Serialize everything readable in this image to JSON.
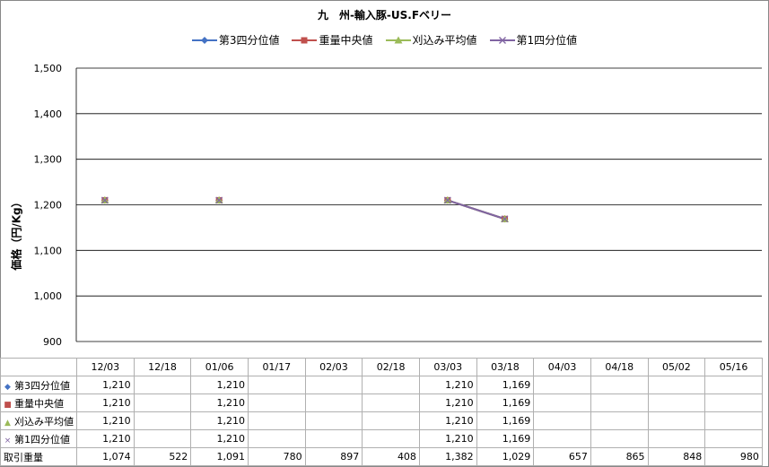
{
  "chart_data": {
    "type": "line",
    "title": "九　州-輸入豚-US.Fベリー",
    "ylabel": "価格（円/Kg）",
    "ylim": [
      900,
      1500
    ],
    "yticks": [
      900,
      1000,
      1100,
      1200,
      1300,
      1400,
      1500
    ],
    "ytick_labels": [
      "900",
      "1,000",
      "1,100",
      "1,200",
      "1,300",
      "1,400",
      "1,500"
    ],
    "categories": [
      "12/03",
      "12/18",
      "01/06",
      "01/17",
      "02/03",
      "02/18",
      "03/03",
      "03/18",
      "04/03",
      "04/18",
      "05/02",
      "05/16"
    ],
    "grid": true,
    "legend_position": "top",
    "series": [
      {
        "name": "第3四分位値",
        "color": "#4472C4",
        "marker": "diamond",
        "values": [
          1210,
          null,
          1210,
          null,
          null,
          null,
          1210,
          1169,
          null,
          null,
          null,
          null
        ]
      },
      {
        "name": "重量中央値",
        "color": "#C0504D",
        "marker": "square",
        "values": [
          1210,
          null,
          1210,
          null,
          null,
          null,
          1210,
          1169,
          null,
          null,
          null,
          null
        ]
      },
      {
        "name": "刈込み平均値",
        "color": "#9BBB59",
        "marker": "triangle",
        "values": [
          1210,
          null,
          1210,
          null,
          null,
          null,
          1210,
          1169,
          null,
          null,
          null,
          null
        ]
      },
      {
        "name": "第1四分位値",
        "color": "#8064A2",
        "marker": "x",
        "values": [
          1210,
          null,
          1210,
          null,
          null,
          null,
          1210,
          1169,
          null,
          null,
          null,
          null
        ]
      }
    ],
    "table": {
      "series_rows": [
        {
          "label": "第3四分位値",
          "values": [
            "1,210",
            "",
            "1,210",
            "",
            "",
            "",
            "1,210",
            "1,169",
            "",
            "",
            "",
            ""
          ]
        },
        {
          "label": "重量中央値",
          "values": [
            "1,210",
            "",
            "1,210",
            "",
            "",
            "",
            "1,210",
            "1,169",
            "",
            "",
            "",
            ""
          ]
        },
        {
          "label": "刈込み平均値",
          "values": [
            "1,210",
            "",
            "1,210",
            "",
            "",
            "",
            "1,210",
            "1,169",
            "",
            "",
            "",
            ""
          ]
        },
        {
          "label": "第1四分位値",
          "values": [
            "1,210",
            "",
            "1,210",
            "",
            "",
            "",
            "1,210",
            "1,169",
            "",
            "",
            "",
            ""
          ]
        }
      ],
      "volume_row": {
        "label": "取引重量",
        "values": [
          "1,074",
          "522",
          "1,091",
          "780",
          "897",
          "408",
          "1,382",
          "1,029",
          "657",
          "865",
          "848",
          "980"
        ]
      }
    }
  }
}
